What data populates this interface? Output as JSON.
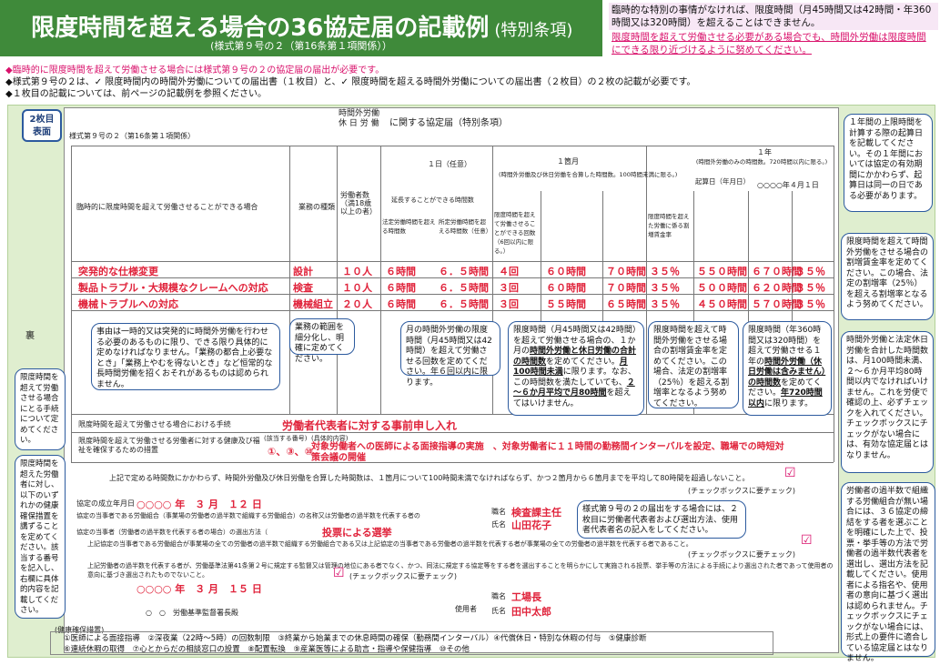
{
  "header": {
    "title": "限度時間を超える場合の36協定届の記載例",
    "title_sub": "(特別条項)",
    "form_ref": "(様式第９号の２（第16条第１項関係））",
    "note1": "臨時的な特別の事情がなければ、限度時間（月45時間又は42時間・年360時間又は320時間）を超えることはできません。",
    "note2": "限度時間を超えて労働させる必要がある場合でも、時間外労働は限度時間にできる限り近づけるように努めてください。"
  },
  "bullets": [
    "◆臨時的に限度時間を超えて労働させる場合には様式第９号の２の協定届の届出が必要です。",
    "◆様式第９号の２は、✓ 限度時間内の時間外労働についての届出書（１枚目）と、✓ 限度時間を超える時間外労働についての届出書（２枚目）の２枚の記載が必要です。",
    "◆１枚目の記載については、前ページの記載例を参照ください。"
  ],
  "tag": {
    "line1": "2枚目",
    "line2": "表面"
  },
  "form": {
    "title_top": "時間外労働",
    "title_bottom": "休 日 労 働",
    "title_suffix": "に関する協定届（特別条項）",
    "form_no": "様式第９号の２（第16条第１項関係）",
    "col_reason": "臨時的に限度時間を超えて労働させることができる場合",
    "col_work": "業務の種類",
    "col_workers": "労働者数（満18歳以上の者）",
    "col_day": "１日（任意）",
    "col_month": "１箇月",
    "col_month_sub": "(時間外労働及び休日労働を合算した時間数。100時間未満に限る。)",
    "col_year": "１年",
    "col_year_sub": "(時間外労働のみの時間数。720時間以内に限る。)",
    "start_label": "起算日（年月日）",
    "start_date": "○○○○年４月１日",
    "h_extend": "延長することができる時間数",
    "h_legal": "法定労働時間を超える時間数",
    "h_fixed": "所定労働時間を超える時間数（任意）",
    "h_count": "限度時間を超えて労働させることができる回数（6回以内に限る。）",
    "h_rate": "限度時間を超えた労働に係る割増賃金率"
  },
  "rows": [
    {
      "reason": "突発的な仕様変更",
      "work": "設計",
      "workers": "１０人",
      "d1": "６時間",
      "d2": "６．５時間",
      "times": "４回",
      "m1": "６０時間",
      "m2": "７０時間",
      "mr": "３５％",
      "y1": "５５０時間",
      "y2": "６７０時間",
      "yr": "３５％"
    },
    {
      "reason": "製品トラブル・大規模なクレームへの対応",
      "work": "検査",
      "workers": "１０人",
      "d1": "６時間",
      "d2": "６．５時間",
      "times": "３回",
      "m1": "６０時間",
      "m2": "７０時間",
      "mr": "３５％",
      "y1": "５００時間",
      "y2": "６２０時間",
      "yr": "３５％"
    },
    {
      "reason": "機械トラブルへの対応",
      "work": "機械組立",
      "workers": "２０人",
      "d1": "６時間",
      "d2": "６．５時間",
      "times": "３回",
      "m1": "５５時間",
      "m2": "６５時間",
      "mr": "３５％",
      "y1": "４５０時間",
      "y2": "５７０時間",
      "yr": "３５％"
    }
  ],
  "callouts": {
    "jiyu": "事由は一時的又は突発的に時間外労働を行わせる必要のあるものに限り、できる限り具体的に定めなければなりません。「業務の都合上必要なとき」「業務上やむを得ないとき」など恒常的な長時間労働を招くおそれがあるものは認められません。",
    "gyomu": "業務の範囲を細分化し、明確に定めてください。",
    "kaisu": "月の時間外労働の限度時間（月45時間又は42時間）を超えて労働させる回数を定めてください。年６回以内に限ります。",
    "genko_a": "限度時間（月45時間又は42時間）を超えて労働させる場合の、１か月の",
    "genko_u": "時間外労働と休日労働の合計の時間数",
    "genko_b": "を定めてください。",
    "genko_u2": "月100時間未満",
    "genko_c": "に限ります。なお、この時間数を満たしていても、",
    "genko_u3": "２～６か月平均で月80時間",
    "genko_d": "を超えてはいけません。",
    "warimashi": "限度時間を超えて時間外労働をさせる場合の割増賃金率を定めてください。この場合、法定の割増率（25％）を超える割増率となるよう努めてください。",
    "nen_a": "限度時間（年360時間又は320時間）を超えて労働させる１年の",
    "nen_u": "時間外労働（休日労働は含みません）の時間数",
    "nen_b": "を定めてください。",
    "nen_u2": "年720時間以内",
    "nen_c": "に限ります。",
    "r1": "１年間の上限時間を計算する際の起算日を記載してください。その１年間においては協定の有効期間にかかわらず、起算日は同一の日である必要があります。",
    "r2": "限度時間を超えて時間外労働をさせる場合の割増賃金率を定めてください。この場合、法定の割増率（25％）を超える割増率となるよう努めてください。",
    "r3": "時間外労働と法定休日労働を合計した時間数は、月100時間未満、２～６か月平均80時間以内でなければいけません。これを労使で確認の上、必ずチェックを入れてください。チェックボックスにチェックがない場合には、有効な協定届とはなりません。",
    "r4": "労働者の過半数で組織する労働組合が無い場合には、３６協定の締結をする者を選ぶことを明確にした上で、投票・挙手等の方法で労働者の過半数代表者を選出し、選出方法を記載してください。使用者による指名や、使用者の意向に基づく選出は認められません。チェックボックスにチェックがない場合には、形式上の要件に適合している協定届とはなりません。",
    "l1": "限度時間を超えて労働させる場合にとる手続について定めてください。",
    "l2": "限度時間を超えた労働者に対し、以下のいずれかの健康確保措置を講ずることを定めてください。該当する番号を記入し、右欄に具体的内容を記載してください。",
    "sig": "様式第９号の２の届出をする場合には、２枚目に労働者代表者および選出方法、使用者代表者名の記入をしてください。"
  },
  "proc": {
    "label": "限度時間を超えて労働させる場合における手続",
    "value": "労働者代表者に対する事前申し入れ"
  },
  "health": {
    "label": "限度時間を超えて労働させる労働者に対する健康及び福祉を確保するための措置",
    "num_label": "(該当する番号)",
    "nums": "①、③、⑩",
    "detail_label": "(具体的内容)",
    "detail": "対象労働者への医師による面接指導の実施　、対象労働者に１１時間の勤務間インターバルを設定、職場での時短対策会議の開催"
  },
  "check1": "上記で定める時間数にかかわらず、時間外労働及び休日労働を合算した時間数は、１箇月について100時間未満でなければならず、かつ２箇月から６箇月までを平均して80時間を超過しないこと。",
  "check_req": "(チェックボックスに要チェック)",
  "sign": {
    "date_label": "協定の成立年月日",
    "date": "○○○○ 年　３ 月　１２ 日",
    "union_label": "協定の当事者である労働組合（事業場の労働者の過半数で組織する労働組合）の名称又は労働者の過半数を代表する者の",
    "rep_label": "協定の当事者（労働者の過半数を代表する者の場合）の選出方法（",
    "method": "投票による選挙",
    "job_label": "職名",
    "job": "検査課主任",
    "name_label": "氏名",
    "name": "山田花子",
    "check2": "上記協定の当事者である労働組合が事業場の全ての労働者の過半数で組織する労働組合である又は上記協定の当事者である労働者の過半数を代表する者が事業場の全ての労働者の過半数を代表する者であること。",
    "check3": "上記労働者の過半数を代表する者が、労働基準法第41条第２号に規定する監督又は管理の地位にある者でなく、かつ、同法に規定する協定等をする者を選出することを明らかにして実施される投票、挙手等の方法による手続により選出された者であって使用者の意向に基づき選出されたものでないこと。",
    "date2": "○○○○ 年　３ 月　１５ 日",
    "employer_label": "使用者",
    "emp_job": "工場長",
    "emp_name": "田中太郎",
    "office": "○　○　労働基準監督署長殿"
  },
  "bottom": {
    "label": "(健康確保措置)",
    "line1": "①医師による面接指導　②深夜業（22時～5時）の回数制限　③終業から始業までの休息時間の確保（勤務間インターバル）④代償休日・特別な休暇の付与　⑤健康診断",
    "line2": "⑥連続休暇の取得　⑦心とからだの相談窓口の設置　⑧配置転換　⑨産業医等による助言・指導や保健指導　⑩その他"
  },
  "side_mark": "裏"
}
